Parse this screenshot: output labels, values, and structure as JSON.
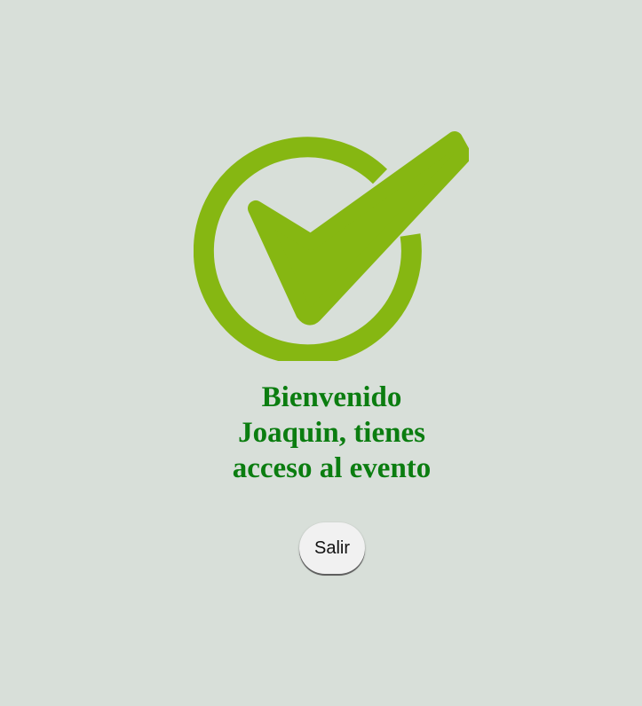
{
  "status": {
    "icon": "check-circle-icon",
    "accent_color": "#86b712"
  },
  "message": {
    "line1": "Bienvenido",
    "line2": "Joaquin, tienes",
    "line3": "acceso al evento",
    "color": "#0b7d10"
  },
  "actions": {
    "exit_label": "Salir"
  }
}
